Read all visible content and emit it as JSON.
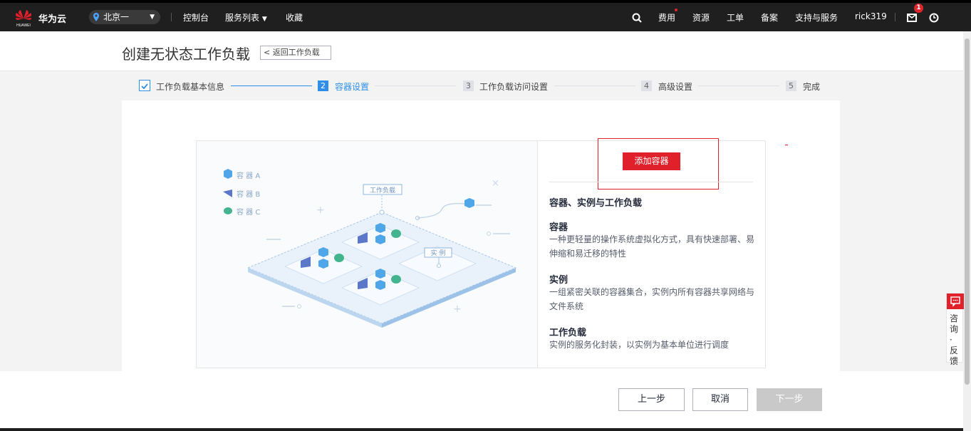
{
  "topbar": {
    "brand": "华为云",
    "region": "北京一",
    "nav": [
      "控制台",
      "服务列表",
      "收藏"
    ],
    "right": [
      "费用",
      "资源",
      "工单",
      "备案",
      "支持与服务",
      "rick319"
    ],
    "badge_count": "1",
    "brand_logo_text": "HUAWEI"
  },
  "header": {
    "title": "创建无状态工作负载",
    "back_label": "返回工作负载"
  },
  "steps": [
    {
      "label": "工作负载基本信息",
      "status": "done"
    },
    {
      "num": "2",
      "label": "容器设置",
      "status": "active"
    },
    {
      "num": "3",
      "label": "工作负载访问设置",
      "status": "todo"
    },
    {
      "num": "4",
      "label": "高级设置",
      "status": "todo"
    },
    {
      "num": "5",
      "label": "完成",
      "status": "todo"
    }
  ],
  "illustration": {
    "legend": [
      "容 器 A",
      "容 器 B",
      "容 器 C"
    ],
    "tag_workload": "工作负载",
    "tag_instance": "实 例"
  },
  "info": {
    "add_button": "添加容器",
    "title": "容器、实例与工作负载",
    "sections": [
      {
        "heading": "容器",
        "text": "一种更轻量的操作系统虚拟化方式，具有快速部署、易伸缩和易迁移的特性"
      },
      {
        "heading": "实例",
        "text": "一组紧密关联的容器集合，实例内所有容器共享网络与文件系统"
      },
      {
        "heading": "工作负载",
        "text": "实例的服务化封装，以实例为基本单位进行调度"
      }
    ]
  },
  "footer": {
    "prev": "上一步",
    "cancel": "取消",
    "next": "下一步"
  },
  "consult": "咨询·反馈",
  "colors": {
    "accent": "#2f8fe8",
    "brand_red": "#e0202b",
    "topbar": "#1f1f1f"
  }
}
